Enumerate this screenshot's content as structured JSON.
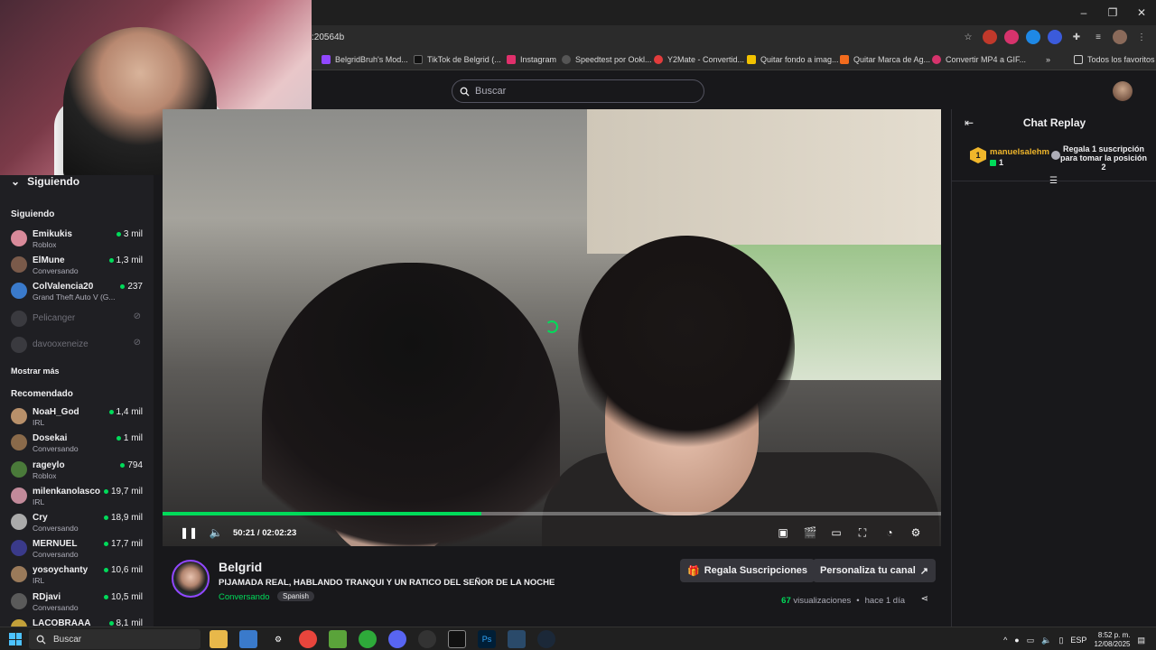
{
  "browser": {
    "url_fragment": ":20564b",
    "bookmarks": [
      {
        "label": "BelgridBruh's Mod...",
        "color": "#9147ff"
      },
      {
        "label": "TikTok de Belgrid (...",
        "color": "#111111"
      },
      {
        "label": "Instagram",
        "color": "#e1306c"
      },
      {
        "label": "Speedtest por Ookl...",
        "color": "#555555"
      },
      {
        "label": "Y2Mate - Convertid...",
        "color": "#e23c3c"
      },
      {
        "label": "Quitar fondo a imag...",
        "color": "#f2c200"
      },
      {
        "label": "Quitar Marca de Ag...",
        "color": "#f26b1d"
      },
      {
        "label": "Convertir MP4 a GIF...",
        "color": "#d6336c"
      }
    ],
    "all_bookmarks": "Todos los favoritos"
  },
  "topnav": {
    "search_placeholder": "Buscar"
  },
  "sidebar": {
    "header": "Siguiendo",
    "following_title": "Siguiendo",
    "following": [
      {
        "name": "Emikukis",
        "sub": "Roblox",
        "count": "3 mil",
        "live": true,
        "avatar": "#d98a9a"
      },
      {
        "name": "ElMune",
        "sub": "Conversando",
        "count": "1,3 mil",
        "live": true,
        "avatar": "#7a5a4a"
      },
      {
        "name": "ColValencia20",
        "sub": "Grand Theft Auto V (G...",
        "count": "237",
        "live": true,
        "avatar": "#3a7acb"
      },
      {
        "name": "Pelicanger",
        "sub": "",
        "count": "",
        "live": false,
        "avatar": "#555"
      },
      {
        "name": "davooxeneize",
        "sub": "",
        "count": "",
        "live": false,
        "avatar": "#555"
      }
    ],
    "show_more": "Mostrar más",
    "recommended_title": "Recomendado",
    "recommended": [
      {
        "name": "NoaH_God",
        "sub": "IRL",
        "count": "1,4 mil",
        "avatar": "#b8906a"
      },
      {
        "name": "Dosekai",
        "sub": "Conversando",
        "count": "1 mil",
        "avatar": "#8a6a4a"
      },
      {
        "name": "rageylo",
        "sub": "Roblox",
        "count": "794",
        "avatar": "#4a7a3a"
      },
      {
        "name": "milenkanolasco",
        "sub": "IRL",
        "count": "19,7 mil",
        "avatar": "#c28a9a"
      },
      {
        "name": "Cry",
        "sub": "Conversando",
        "count": "18,9 mil",
        "avatar": "#aaaaaa"
      },
      {
        "name": "MERNUEL",
        "sub": "Conversando",
        "count": "17,7 mil",
        "avatar": "#3a3a8a"
      },
      {
        "name": "yosoychanty",
        "sub": "IRL",
        "count": "10,6 mil",
        "avatar": "#9a7a5a"
      },
      {
        "name": "RDjavi",
        "sub": "Conversando",
        "count": "10,5 mil",
        "avatar": "#5a5a5a"
      },
      {
        "name": "LACOBRAAA",
        "sub": "",
        "count": "8,1 mil",
        "avatar": "#c2a03a"
      }
    ]
  },
  "player": {
    "time": "50:21 / 02:02:23",
    "progress": 0.41
  },
  "chat": {
    "title": "Chat Replay",
    "leader_rank": "1",
    "leader_name": "manuelsalehm",
    "leader_subs": "1",
    "leader_gift": "Regala 1 suscripción para tomar la posición 2"
  },
  "channel": {
    "name": "Belgrid",
    "title": "PIJAMADA REAL, HABLANDO TRANQUI Y UN RATICO DEL SEÑOR DE LA NOCHE",
    "category": "Conversando",
    "tag": "Spanish",
    "gift_button": "Regala Suscripciones",
    "customize_button": "Personaliza tu canal",
    "views_count": "67",
    "views_label": "visualizaciones",
    "age": "hace 1 día"
  },
  "taskbar": {
    "search": "Buscar",
    "lang": "ESP",
    "time": "8:52 p. m.",
    "date": "12/08/2025"
  }
}
